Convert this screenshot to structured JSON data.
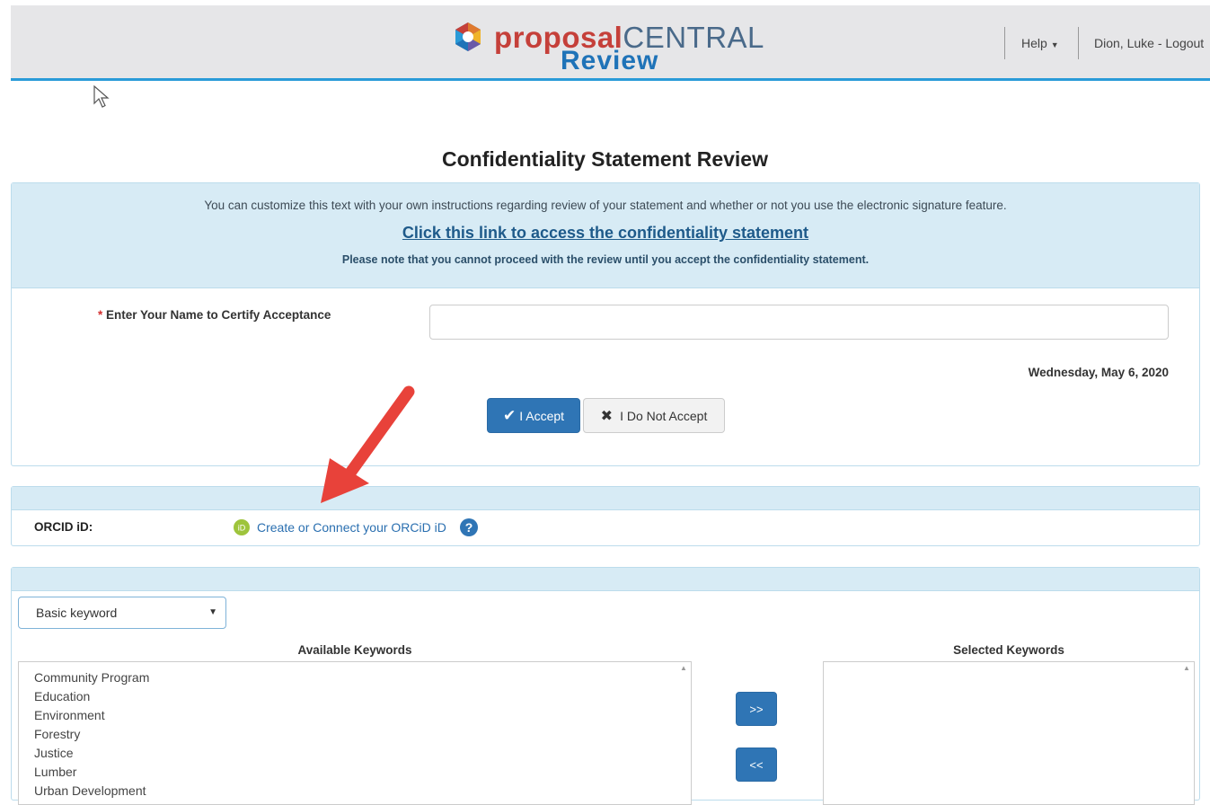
{
  "header": {
    "brand_part1": "proposal",
    "brand_part2": "CENTRAL",
    "brand_sub": "Review",
    "help_label": "Help",
    "user_label": "Dion, Luke - Logout"
  },
  "page": {
    "title": "Confidentiality Statement Review"
  },
  "confidentiality": {
    "instructions": "You can customize this text with your own instructions regarding review of your statement and whether or not you use the electronic signature feature.",
    "link_text": "Click this link to access the confidentiality statement",
    "note": "Please note that you cannot proceed with the review until you accept the confidentiality statement.",
    "required_marker": "*",
    "name_label": "Enter Your Name to Certify Acceptance",
    "name_value": "",
    "date": "Wednesday, May 6, 2020",
    "accept_label": "I Accept",
    "decline_label": "I Do Not Accept"
  },
  "orcid": {
    "label": "ORCID iD:",
    "link_text": "Create or Connect your ORCiD iD",
    "icon_text": "iD",
    "help_icon_text": "?"
  },
  "keywords": {
    "type_selected": "Basic keyword",
    "available_heading": "Available Keywords",
    "selected_heading": "Selected Keywords",
    "available": [
      "Community Program",
      "Education",
      "Environment",
      "Forestry",
      "Justice",
      "Lumber",
      "Urban Development"
    ],
    "selected": [],
    "add_label": ">>",
    "remove_label": "<<"
  },
  "colors": {
    "accent": "#2f75b5",
    "panel_header": "#d7ebf5",
    "annotation_arrow": "#e8423a"
  }
}
